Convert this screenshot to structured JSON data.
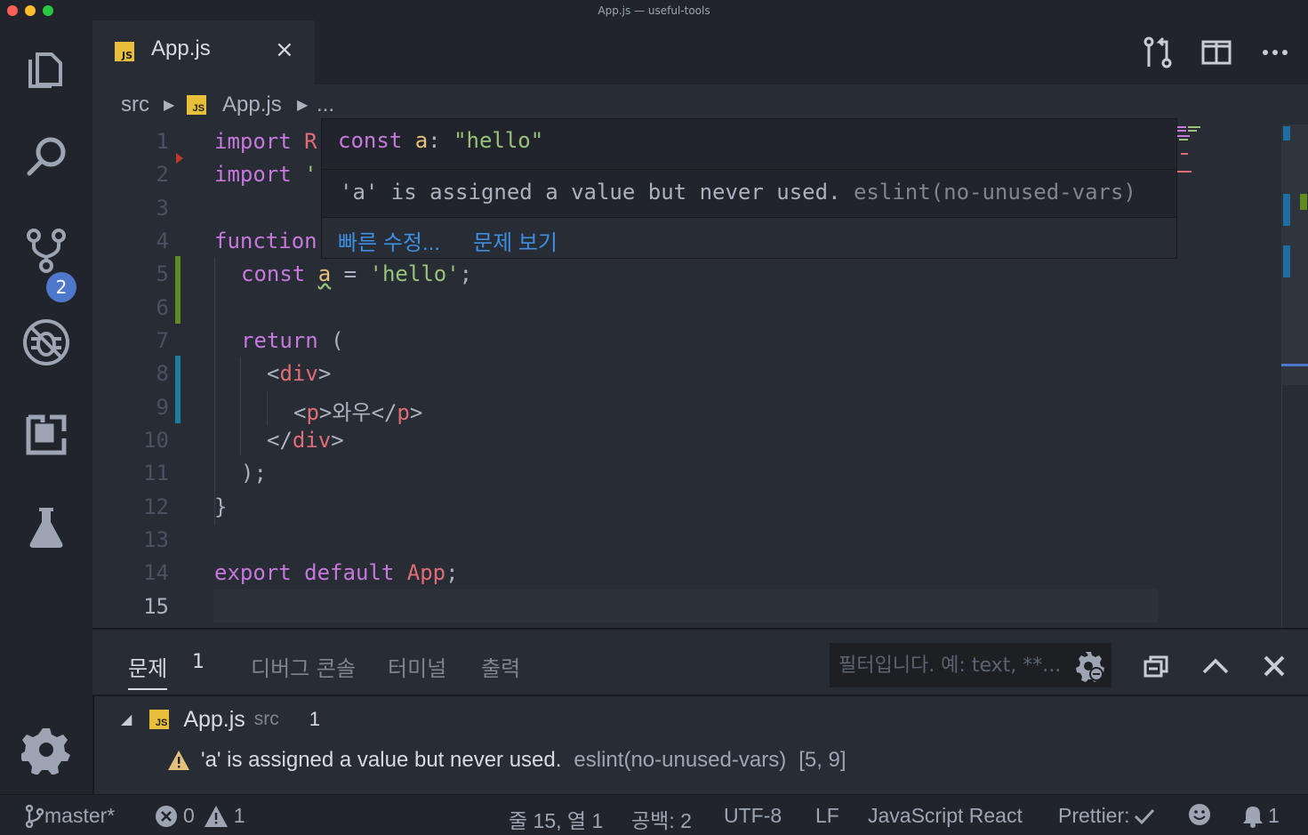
{
  "window": {
    "title": "App.js — useful-tools"
  },
  "activity_bar": {
    "scm_badge": "2"
  },
  "tab": {
    "label": "App.js",
    "close": "×",
    "js_badge": "JS"
  },
  "breadcrumb": {
    "folder": "src",
    "file": "App.js",
    "more": "..."
  },
  "editor": {
    "line_numbers": [
      "1",
      "2",
      "3",
      "4",
      "5",
      "6",
      "7",
      "8",
      "9",
      "10",
      "11",
      "12",
      "13",
      "14",
      "15"
    ],
    "lines": {
      "l1_kw": "import",
      "l1_rest": " R",
      "l2_kw": "import",
      "l2_rest": " '",
      "l4_kw": "function",
      "l5_kw": "const",
      "l5_var": "a",
      "l5_eq": " = ",
      "l5_str": "'hello'",
      "l5_end": ";",
      "l7_kw": "return",
      "l7_rest": " (",
      "l8_open": "<",
      "l8_tag": "div",
      "l8_close": ">",
      "l9_open": "<",
      "l9_tag": "p",
      "l9_mid": ">와우</",
      "l9_tag2": "p",
      "l9_close": ">",
      "l10_open": "</",
      "l10_tag": "div",
      "l10_close": ">",
      "l11": ");",
      "l12": "}",
      "l14_kw1": "export",
      "l14_kw2": "default",
      "l14_name": "App",
      "l14_end": ";"
    }
  },
  "hover": {
    "sig_kw": "const",
    "sig_var": "a",
    "sig_colon": ": ",
    "sig_str": "\"hello\"",
    "message": "'a' is assigned a value but never used.",
    "source": "eslint(no-unused-vars)",
    "quick_fix": "빠른 수정...",
    "view_problem": "문제 보기"
  },
  "panel": {
    "tabs": [
      {
        "label": "문제",
        "count": "1"
      },
      {
        "label": "디버그 콘솔"
      },
      {
        "label": "터미널"
      },
      {
        "label": "출력"
      }
    ],
    "filter_placeholder": "필터입니다. 예: text, **...",
    "problem_file": {
      "name": "App.js",
      "folder": "src",
      "count": "1"
    },
    "problem": {
      "message": "'a' is assigned a value but never used.",
      "source": "eslint(no-unused-vars)",
      "position": "[5, 9]"
    }
  },
  "status": {
    "branch": "master*",
    "errors": "0",
    "warnings": "1",
    "cursor": "줄 15, 열 1",
    "spaces": "공백: 2",
    "encoding": "UTF-8",
    "eol": "LF",
    "language": "JavaScript React",
    "prettier": "Prettier:",
    "notifications": "1"
  },
  "colors": {
    "background": "#282c34",
    "sidebar": "#21252b",
    "keyword": "#c678dd",
    "string": "#98c379",
    "tag": "#e06c75",
    "variable": "#e5c07b",
    "link": "#3e8fe4",
    "badge": "#4d78cc",
    "warning": "#e5c07b"
  }
}
